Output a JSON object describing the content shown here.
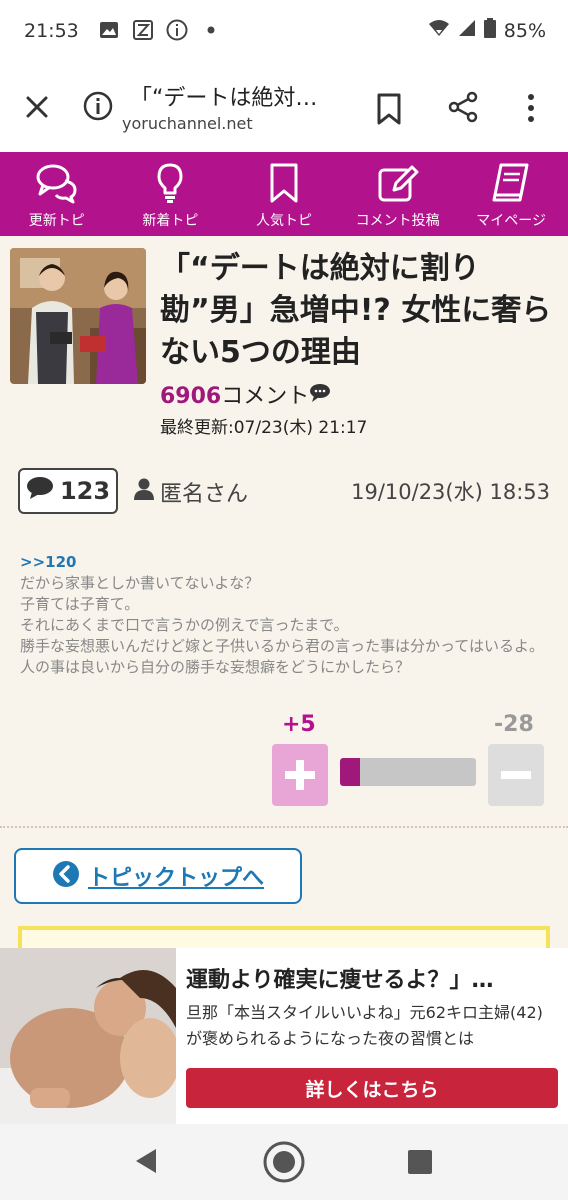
{
  "status_bar": {
    "time": "21:53",
    "battery": "85%",
    "icons": [
      "image-icon",
      "app-icon",
      "info-icon",
      "dot-icon",
      "wifi-icon",
      "signal-icon",
      "battery-icon"
    ]
  },
  "browser": {
    "title": "「“デートは絶対…",
    "url": "yoruchannel.net"
  },
  "site_nav": {
    "items": [
      {
        "label": "更新トピ",
        "icon": "chat-icon"
      },
      {
        "label": "新着トピ",
        "icon": "bulb-icon"
      },
      {
        "label": "人気トピ",
        "icon": "bookmark-icon"
      },
      {
        "label": "コメント投稿",
        "icon": "edit-icon"
      },
      {
        "label": "マイページ",
        "icon": "book-icon"
      }
    ],
    "color": "#b3128d"
  },
  "article": {
    "title": "「“デートは絶対に割り勘”男」急増中!? 女性に奢らない5つの理由",
    "comment_count": "6906",
    "comment_suffix": "コメント",
    "updated": "最終更新:07/23(木) 21:17"
  },
  "post": {
    "number": "123",
    "author": "匿名さん",
    "date": "19/10/23(水) 18:53",
    "anchor": ">>120",
    "lines": [
      "だから家事としか書いてないよな？",
      "子育ては子育て。",
      "それにあくまで口で言うかの例えで言ったまで。",
      "勝手な妄想悪いんだけど嫁と子供いるから君の言った事は分かってはいるよ。",
      "人の事は良いから自分の勝手な妄想癖をどうにかしたら？"
    ],
    "votes": {
      "plus": "+5",
      "minus": "-28",
      "plus_ratio": 0.15
    }
  },
  "topic_button": {
    "label": "トピックトップへ"
  },
  "ad": {
    "title": "運動より確実に痩せるよ？」…",
    "description": "旦那「本当スタイルいいよね」元62キロ主婦(42)が褒められるようになった夜の習慣とは",
    "button": "詳しくはこちら"
  }
}
